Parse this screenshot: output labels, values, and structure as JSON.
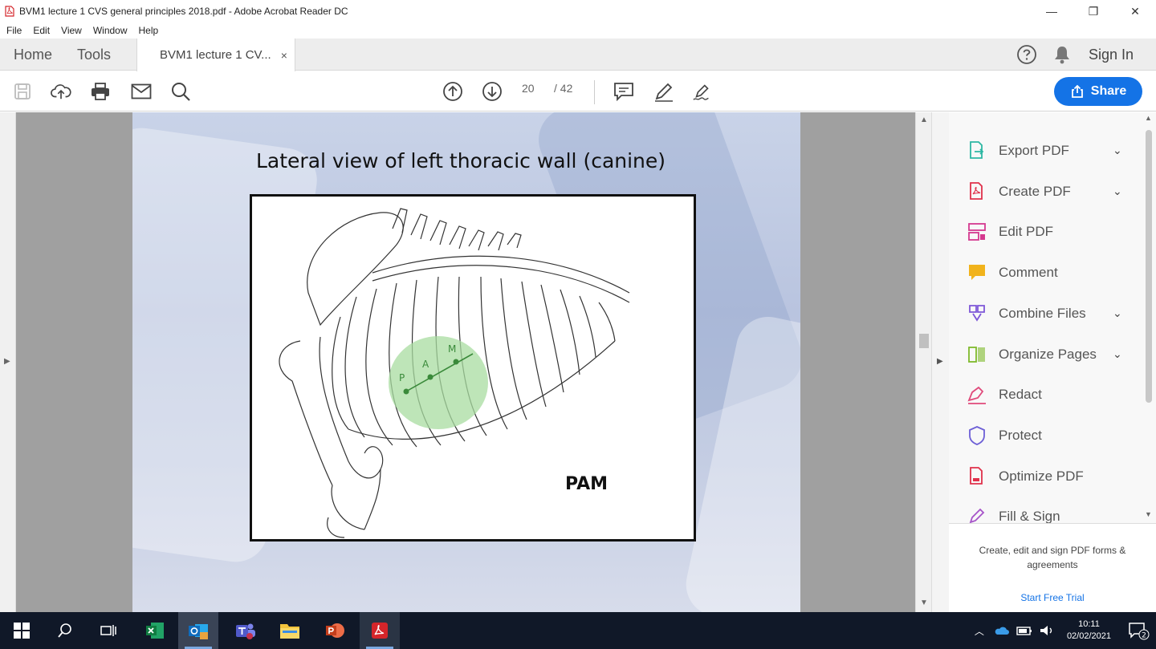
{
  "window": {
    "title": "BVM1 lecture 1 CVS general principles 2018.pdf - Adobe Acrobat Reader DC",
    "minimize": "—",
    "maximize": "❐",
    "close": "✕"
  },
  "menu": [
    "File",
    "Edit",
    "View",
    "Window",
    "Help"
  ],
  "tabs": {
    "home": "Home",
    "tools": "Tools",
    "document": "BVM1 lecture 1 CV...",
    "close": "×",
    "sign_in": "Sign In"
  },
  "toolbar": {
    "current_page": "20",
    "page_total": "/ 42",
    "share_label": "Share"
  },
  "slide": {
    "title": "Lateral view of left thoracic wall (canine)",
    "figure_label": "PAM",
    "markers": [
      "P",
      "A",
      "M"
    ]
  },
  "right_panel": {
    "tools": [
      {
        "label": "Export PDF",
        "icon": "export-pdf-icon",
        "color": "#2db7a3",
        "expandable": true
      },
      {
        "label": "Create PDF",
        "icon": "create-pdf-icon",
        "color": "#e0314b",
        "expandable": true
      },
      {
        "label": "Edit PDF",
        "icon": "edit-pdf-icon",
        "color": "#d5398f",
        "expandable": false
      },
      {
        "label": "Comment",
        "icon": "comment-icon",
        "color": "#f1b31c",
        "expandable": false
      },
      {
        "label": "Combine Files",
        "icon": "combine-files-icon",
        "color": "#7e57d8",
        "expandable": true
      },
      {
        "label": "Organize Pages",
        "icon": "organize-pages-icon",
        "color": "#7fba2c",
        "expandable": true
      },
      {
        "label": "Redact",
        "icon": "redact-icon",
        "color": "#e04a7b",
        "expandable": false
      },
      {
        "label": "Protect",
        "icon": "protect-icon",
        "color": "#6d5fd6",
        "expandable": false
      },
      {
        "label": "Optimize PDF",
        "icon": "optimize-pdf-icon",
        "color": "#e0314b",
        "expandable": false
      },
      {
        "label": "Fill & Sign",
        "icon": "fill-sign-icon",
        "color": "#a653c9",
        "expandable": false
      }
    ],
    "promo": "Create, edit and sign PDF forms & agreements",
    "trial_link": "Start Free Trial"
  },
  "taskbar": {
    "time": "10:11",
    "date": "02/02/2021",
    "notification_count": "2"
  },
  "colors": {
    "accent": "#1473e6",
    "taskbar": "#101828",
    "lung_field": "#a8dca0"
  }
}
